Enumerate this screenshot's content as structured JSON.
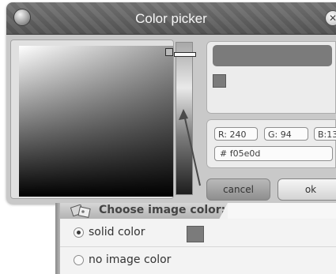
{
  "dialog": {
    "title": "Color picker",
    "close_label": "✕"
  },
  "color": {
    "r_label": "R: 240",
    "g_label": "G: 94",
    "b_label": "B:13",
    "hex_label": "# f05e0d",
    "hex": "#f05e0d"
  },
  "buttons": {
    "cancel": "cancel",
    "ok": "ok"
  },
  "image_color": {
    "title": "Choose image color:",
    "options": [
      {
        "label": "solid color",
        "selected": true
      },
      {
        "label": "no image color",
        "selected": false
      }
    ]
  },
  "icons": {
    "title": "app-orb-icon",
    "close": "close-icon",
    "panel": "image-icon"
  }
}
